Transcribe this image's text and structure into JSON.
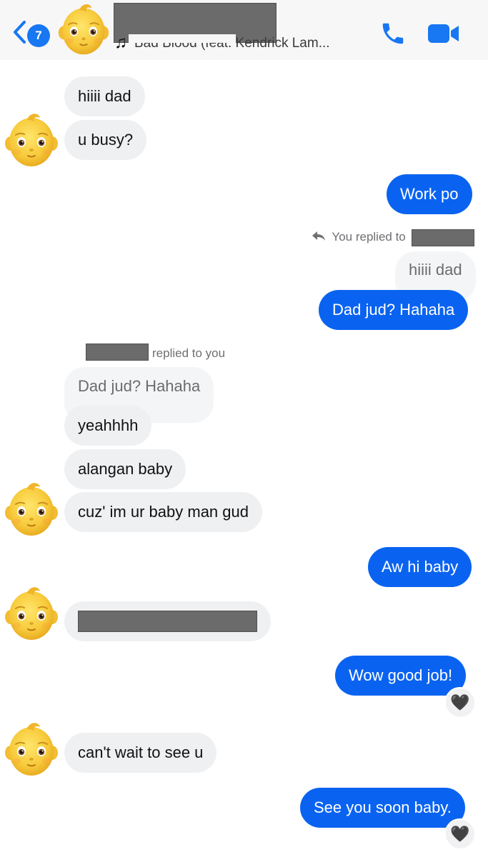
{
  "header": {
    "unread_count": "7",
    "now_playing": "Bad Blood (feat. Kendrick Lam...",
    "contact_name_redacted": true
  },
  "colors": {
    "accent": "#0a63f0",
    "incoming_bubble": "#eff0f2",
    "header_bg": "#f7f7f7",
    "reaction": "#111111"
  },
  "messages": {
    "m1": "hiiii dad",
    "m2": "u busy?",
    "m3": "Work po",
    "m4_meta": "You replied to",
    "m4_quote": "hiiii dad",
    "m4": "Dad jud? Hahaha",
    "m5_meta": "replied to you",
    "m5_quote": "Dad jud? Hahaha",
    "m5": "yeahhhh",
    "m6": "alangan baby",
    "m7": "cuz' im ur baby man gud",
    "m8": "Aw hi baby",
    "m10": "Wow good job!",
    "m11": "can't wait to see u",
    "m12": "See you soon baby."
  },
  "reactions": {
    "r1": "🖤",
    "r2": "🖤"
  },
  "icons": {
    "back": "chevron-left-icon",
    "call": "phone-icon",
    "video": "video-camera-icon",
    "reply": "reply-arrow-icon",
    "music": "music-note-icon",
    "avatar": "baby-memoji-avatar"
  }
}
